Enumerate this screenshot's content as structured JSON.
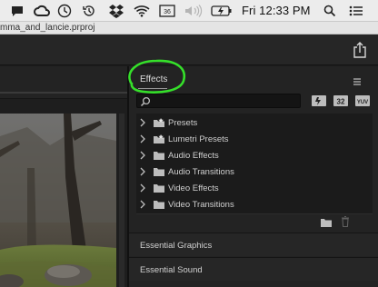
{
  "menubar": {
    "time": "Fri 12:33 PM",
    "icons": [
      "notification-icon",
      "creative-cloud-icon",
      "clock-icon",
      "time-machine-icon",
      "dropbox-icon",
      "wifi-icon",
      "display-icon",
      "volume-icon",
      "battery-icon",
      "spotlight-icon",
      "menu-list-icon"
    ]
  },
  "titlebar": {
    "filename": "mma_and_lancie.prproj"
  },
  "header": {
    "share_icon": "share-icon"
  },
  "effects_panel": {
    "title": "Effects",
    "search_placeholder": "",
    "filter_buttons": [
      "32",
      "YUV"
    ],
    "tree": [
      {
        "label": "Presets",
        "icon": "preset-folder-icon"
      },
      {
        "label": "Lumetri Presets",
        "icon": "preset-folder-icon"
      },
      {
        "label": "Audio Effects",
        "icon": "folder-icon"
      },
      {
        "label": "Audio Transitions",
        "icon": "folder-icon"
      },
      {
        "label": "Video Effects",
        "icon": "folder-icon"
      },
      {
        "label": "Video Transitions",
        "icon": "folder-icon"
      }
    ],
    "sections": [
      "Essential Graphics",
      "Essential Sound"
    ]
  },
  "annotation_color": "#35e02a"
}
